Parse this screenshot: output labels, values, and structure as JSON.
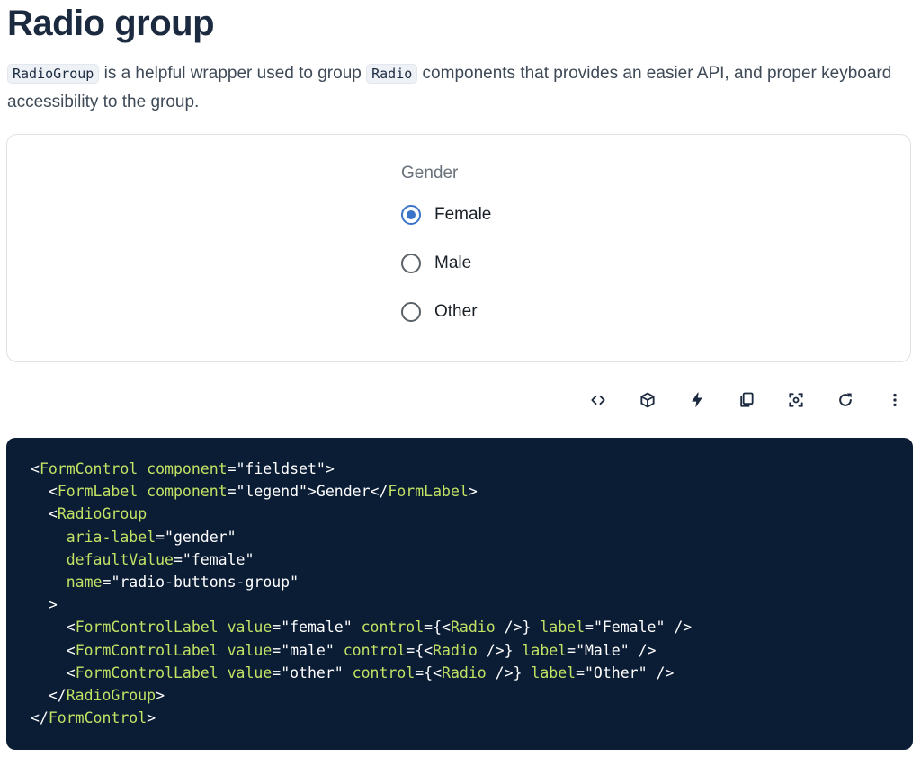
{
  "page": {
    "title": "Radio group",
    "intro": {
      "code1": "RadioGroup",
      "text1": " is a helpful wrapper used to group ",
      "code2": "Radio",
      "text2": " components that provides an easier API, and proper keyboard accessibility to the group."
    }
  },
  "demo": {
    "legend": "Gender",
    "options": [
      {
        "label": "Female",
        "checked": true
      },
      {
        "label": "Male",
        "checked": false
      },
      {
        "label": "Other",
        "checked": false
      }
    ]
  },
  "toolbar": {
    "buttons": [
      {
        "icon": "code-icon"
      },
      {
        "icon": "cube-icon"
      },
      {
        "icon": "bolt-icon"
      },
      {
        "icon": "copy-icon"
      },
      {
        "icon": "focus-icon"
      },
      {
        "icon": "refresh-icon"
      },
      {
        "icon": "more-vertical-icon"
      }
    ]
  },
  "code": {
    "lines": [
      [
        [
          "p",
          "<"
        ],
        [
          "c",
          "FormControl"
        ],
        [
          "t",
          " "
        ],
        [
          "a",
          "component"
        ],
        [
          "p",
          "="
        ],
        [
          "s",
          "\"fieldset\""
        ],
        [
          "p",
          ">"
        ]
      ],
      [
        [
          "t",
          "  "
        ],
        [
          "p",
          "<"
        ],
        [
          "c",
          "FormLabel"
        ],
        [
          "t",
          " "
        ],
        [
          "a",
          "component"
        ],
        [
          "p",
          "="
        ],
        [
          "s",
          "\"legend\""
        ],
        [
          "p",
          ">"
        ],
        [
          "t",
          "Gender"
        ],
        [
          "p",
          "</"
        ],
        [
          "c",
          "FormLabel"
        ],
        [
          "p",
          ">"
        ]
      ],
      [
        [
          "t",
          "  "
        ],
        [
          "p",
          "<"
        ],
        [
          "c",
          "RadioGroup"
        ]
      ],
      [
        [
          "t",
          "    "
        ],
        [
          "a",
          "aria-label"
        ],
        [
          "p",
          "="
        ],
        [
          "s",
          "\"gender\""
        ]
      ],
      [
        [
          "t",
          "    "
        ],
        [
          "a",
          "defaultValue"
        ],
        [
          "p",
          "="
        ],
        [
          "s",
          "\"female\""
        ]
      ],
      [
        [
          "t",
          "    "
        ],
        [
          "a",
          "name"
        ],
        [
          "p",
          "="
        ],
        [
          "s",
          "\"radio-buttons-group\""
        ]
      ],
      [
        [
          "t",
          "  "
        ],
        [
          "p",
          ">"
        ]
      ],
      [
        [
          "t",
          "    "
        ],
        [
          "p",
          "<"
        ],
        [
          "c",
          "FormControlLabel"
        ],
        [
          "t",
          " "
        ],
        [
          "a",
          "value"
        ],
        [
          "p",
          "="
        ],
        [
          "s",
          "\"female\""
        ],
        [
          "t",
          " "
        ],
        [
          "a",
          "control"
        ],
        [
          "p",
          "={<"
        ],
        [
          "c",
          "Radio"
        ],
        [
          "p",
          " />}"
        ],
        [
          "t",
          " "
        ],
        [
          "a",
          "label"
        ],
        [
          "p",
          "="
        ],
        [
          "s",
          "\"Female\""
        ],
        [
          "p",
          " />"
        ]
      ],
      [
        [
          "t",
          "    "
        ],
        [
          "p",
          "<"
        ],
        [
          "c",
          "FormControlLabel"
        ],
        [
          "t",
          " "
        ],
        [
          "a",
          "value"
        ],
        [
          "p",
          "="
        ],
        [
          "s",
          "\"male\""
        ],
        [
          "t",
          " "
        ],
        [
          "a",
          "control"
        ],
        [
          "p",
          "={<"
        ],
        [
          "c",
          "Radio"
        ],
        [
          "p",
          " />}"
        ],
        [
          "t",
          " "
        ],
        [
          "a",
          "label"
        ],
        [
          "p",
          "="
        ],
        [
          "s",
          "\"Male\""
        ],
        [
          "p",
          " />"
        ]
      ],
      [
        [
          "t",
          "    "
        ],
        [
          "p",
          "<"
        ],
        [
          "c",
          "FormControlLabel"
        ],
        [
          "t",
          " "
        ],
        [
          "a",
          "value"
        ],
        [
          "p",
          "="
        ],
        [
          "s",
          "\"other\""
        ],
        [
          "t",
          " "
        ],
        [
          "a",
          "control"
        ],
        [
          "p",
          "={<"
        ],
        [
          "c",
          "Radio"
        ],
        [
          "p",
          " />}"
        ],
        [
          "t",
          " "
        ],
        [
          "a",
          "label"
        ],
        [
          "p",
          "="
        ],
        [
          "s",
          "\"Other\""
        ],
        [
          "p",
          " />"
        ]
      ],
      [
        [
          "t",
          "  "
        ],
        [
          "p",
          "</"
        ],
        [
          "c",
          "RadioGroup"
        ],
        [
          "p",
          ">"
        ]
      ],
      [
        [
          "p",
          "</"
        ],
        [
          "c",
          "FormControl"
        ],
        [
          "p",
          ">"
        ]
      ]
    ]
  },
  "colors": {
    "accent": "#3a73c8",
    "code_bg": "#0b1c35",
    "code_highlight": "#c2e264"
  }
}
